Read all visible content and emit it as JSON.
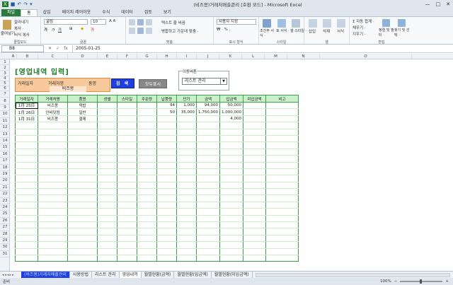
{
  "window": {
    "title": "(비즈몽)거래처매출관리 [호환 모드] - Microsoft Excel",
    "qat_icons": [
      "save-icon",
      "undo-icon",
      "redo-icon"
    ]
  },
  "ribbon_tabs": [
    "파일",
    "홈",
    "삽입",
    "페이지 레이아웃",
    "수식",
    "데이터",
    "검토",
    "보기"
  ],
  "ribbon": {
    "clipboard": {
      "paste": "붙여넣기",
      "cut": "잘라내기",
      "copy": "복사 ·",
      "format_painter": "서식 복사",
      "label": "클립보드"
    },
    "font": {
      "name": "굴림",
      "size": "10",
      "label": "글꼴"
    },
    "alignment": {
      "wrap": "텍스트 줄 바꿈",
      "merge": "병합하고 가운데 맞춤 ·",
      "label": "맞춤"
    },
    "number": {
      "format": "사용자 지정",
      "label": "표시 형식"
    },
    "styles": {
      "conditional": "조건부 서식 ·",
      "table": "표 서식 ·",
      "cell": "셀 스타일 ·",
      "label": "스타일"
    },
    "cells": {
      "insert": "삽입",
      "delete": "삭제",
      "format": "서식",
      "label": "셀"
    },
    "editing": {
      "autosum": "자동 합계 ·",
      "fill": "채우기 ·",
      "clear": "지우기 ·",
      "sort": "정렬 및 필터 ·",
      "find": "찾기 및 선택 ·",
      "label": "편집"
    }
  },
  "formula_bar": {
    "name_box": "B8",
    "fx": "fx",
    "content": "2005-01-25"
  },
  "columns": [
    "A",
    "B",
    "C",
    "D",
    "E",
    "F",
    "G",
    "H",
    "I",
    "J",
    "K",
    "L",
    "M",
    "N",
    "O"
  ],
  "rows": [
    "1",
    "2",
    "3",
    "4",
    "5",
    "6",
    "7",
    "8",
    "9",
    "10",
    "11",
    "12",
    "13",
    "14",
    "15",
    "16",
    "17",
    "18",
    "19",
    "20",
    "21",
    "22",
    "23",
    "24",
    "25",
    "26",
    "27",
    "28",
    "29",
    "30",
    "31"
  ],
  "sheet": {
    "title": "[영업내역 입력]",
    "search": {
      "label_date": "거래일자",
      "label_client": "거래처명",
      "label_item": "품명",
      "client_value": "비즈몽",
      "search_button": "검 색",
      "show_all_button": "모두표시"
    },
    "move_panel": {
      "legend": "이동버튼",
      "selected": "리스트 관리"
    },
    "table": {
      "headers": [
        "거래일자",
        "거래처명",
        "품명",
        "성별",
        "스타일",
        "주문량",
        "납품량",
        "단가",
        "금액",
        "입금액",
        "미입금액",
        "비고"
      ],
      "rows": [
        [
          "1月 25日",
          "비즈몽",
          "먹밥",
          "",
          "",
          "",
          "94",
          "1,000",
          "94,000",
          "50,000",
          "",
          ""
        ],
        [
          "1月 26日",
          "안비닷컴",
          "일반",
          "",
          "",
          "",
          "50",
          "35,000",
          "1,750,000",
          "1,000,000",
          "",
          ""
        ],
        [
          "1月 31日",
          "비즈몽",
          "결제",
          "",
          "",
          "",
          "",
          "",
          "",
          "4,000",
          "",
          ""
        ]
      ],
      "empty_rows": 21
    }
  },
  "sheet_tabs": [
    "(비즈몽)거래처매출관리",
    "사용방법",
    "리스트 관리",
    "영업내역",
    "월별현황(금액)",
    "월별현황(입금액)",
    "월별현황(미입금액)"
  ],
  "active_sheet": "영업내역",
  "status": {
    "mode": "준비",
    "zoom": "100%"
  }
}
